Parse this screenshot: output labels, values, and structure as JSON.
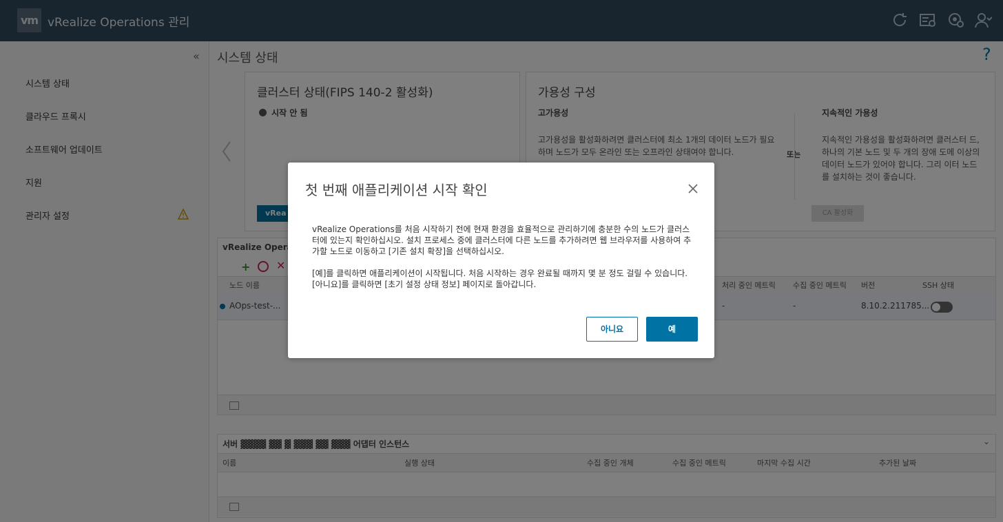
{
  "header": {
    "logo": "vm",
    "title": "vRealize Operations 관리",
    "icons": [
      "refresh-icon",
      "log-icon",
      "settings-icon",
      "user-icon"
    ]
  },
  "sidebar": {
    "collapse": "«",
    "items": [
      {
        "label": "시스템 상태"
      },
      {
        "label": "클라우드 프록시"
      },
      {
        "label": "소프트웨어 업데이트"
      },
      {
        "label": "지원"
      },
      {
        "label": "관리자 설정"
      }
    ]
  },
  "page": {
    "title": "시스템 상태",
    "help": "?"
  },
  "cluster_card": {
    "title": "클러스터 상태(FIPS 140-2 활성화)",
    "status": "시작 안 됨",
    "button": "vRea"
  },
  "availability_card": {
    "title": "가용성 구성",
    "ha_title": "고가용성",
    "ha_text": "고가용성을 활성화하려면 클러스터에 최소 1개의 데이터 노드가 필요하며 노드가 모두 온라인 또는 오프라인 상태여야 합니다.",
    "or": "또는",
    "ca_title": "지속적인 가용성",
    "ca_text": "지속적인 가용성을 활성화하려면 클러스터 드, 하나의 기본 노드 및 두 개의 장애 도메 이상의 데이터 노드가 있어야 합니다. 그리 이터 노드를 설치하는 것이 좋습니다.",
    "ca_button": "CA 활성화"
  },
  "nodes_grid": {
    "title": "vRealize Operati",
    "headers": [
      "노드 이름",
      "처리 중인 메트릭",
      "수집 중인 메트릭",
      "버전",
      "SSH 상태"
    ],
    "rows": [
      {
        "name": "AOps-test-...",
        "processing": "-",
        "collecting": "-",
        "version": "8.10.2.211785..."
      }
    ]
  },
  "adapter_grid": {
    "title": "서버 ▓▓▓▓ ▓▓ ▓ ▓▓▓ ▓▓ ▓▓▓ 어댑터 인스턴스",
    "headers": [
      "이름",
      "실행 상태",
      "수집 중인 개체",
      "수집 중인 메트릭",
      "마지막 수집 시간",
      "추가된 날짜"
    ]
  },
  "modal": {
    "title": "첫 번째 애플리케이션 시작 확인",
    "p1": "vRealize Operations를 처음 시작하기 전에 현재 환경을 효율적으로 관리하기에 충분한 수의 노드가 클러스터에 있는지 확인하십시오. 설치 프로세스 중에 클러스터에 다른 노드를 추가하려면 웹 브라우저를 사용하여 추가할 노드로 이동하고 [기존 설치 확장]을 선택하십시오.",
    "p2": "[예]를 클릭하면 애플리케이션이 시작됩니다. 처음 시작하는 경우 완료될 때까지 몇 분 정도 걸릴 수 있습니다. [아니요]를 클릭하면 [초기 설정 상태 정보] 페이지로 돌아갑니다.",
    "no_label": "아니요",
    "yes_label": "예"
  },
  "colors": {
    "header": "#31485c",
    "accent": "#0072a3"
  }
}
